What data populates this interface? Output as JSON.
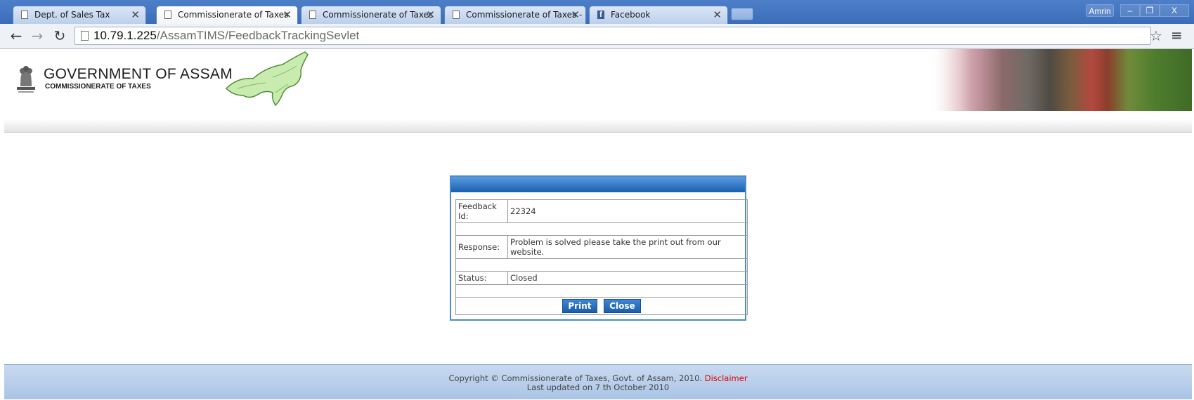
{
  "browser": {
    "tabs": [
      {
        "title": "Dept. of Sales Tax",
        "icon": "page-icon",
        "active": false
      },
      {
        "title": "Commissionerate of Taxes",
        "icon": "page-icon",
        "active": true
      },
      {
        "title": "Commissionerate of Taxes",
        "icon": "page-icon",
        "active": false
      },
      {
        "title": "Commissionerate of Taxes -",
        "icon": "page-icon",
        "active": false
      },
      {
        "title": "Facebook",
        "icon": "facebook-icon",
        "active": false
      }
    ],
    "close_glyph": "✕",
    "profile_name": "Amrin",
    "window_buttons": {
      "minimize": "–",
      "restore": "❐",
      "close": "X"
    },
    "url_host": "10.79.1.225",
    "url_path": "/AssamTIMS/FeedbackTrackingSevlet"
  },
  "header": {
    "title": "GOVERNMENT OF ASSAM",
    "subtitle": "COMMISSIONERATE OF TAXES"
  },
  "feedback": {
    "id_label": "Feedback Id:",
    "id_value": "22324",
    "response_label": "Response:",
    "response_value": "Problem is solved please take the print out from our website.",
    "status_label": "Status:",
    "status_value": "Closed",
    "print_label": "Print",
    "close_label": "Close"
  },
  "footer": {
    "copyright": "Copyright © Commissionerate of Taxes, Govt. of Assam, 2010.",
    "disclaimer": "Disclaimer",
    "last_updated": "Last updated on 7 th October 2010"
  },
  "colors": {
    "tabbar": "#3b6cb8",
    "dialog_header": "#1a5fb0",
    "button": "#1b5eab",
    "disclaimer": "#e00000",
    "footer": "#c9daf0"
  }
}
